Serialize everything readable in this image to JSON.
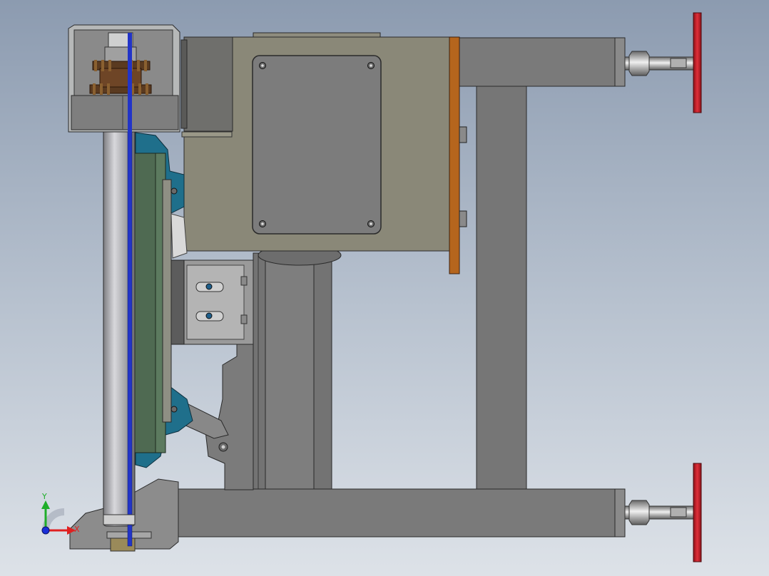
{
  "view": {
    "background_top": "#8c9bb0",
    "background_bottom": "#dde2e8"
  },
  "triad": {
    "y_label": "Y",
    "x_label": "X",
    "y_color": "#1fae2a",
    "x_color": "#e02020",
    "z_color": "#1a2fd8"
  },
  "colors": {
    "frame_gray": "#7a7a7a",
    "panel_khaki": "#8a8878",
    "motor_plate": "#7c7c7c",
    "copper_plate": "#b5651d",
    "hand_wheel": "#c8202c",
    "teal_bracket": "#1f6f8b",
    "green_plate": "#4f6a52",
    "roller": "#a8a8ac",
    "gear_bronze": "#5a3a20"
  }
}
